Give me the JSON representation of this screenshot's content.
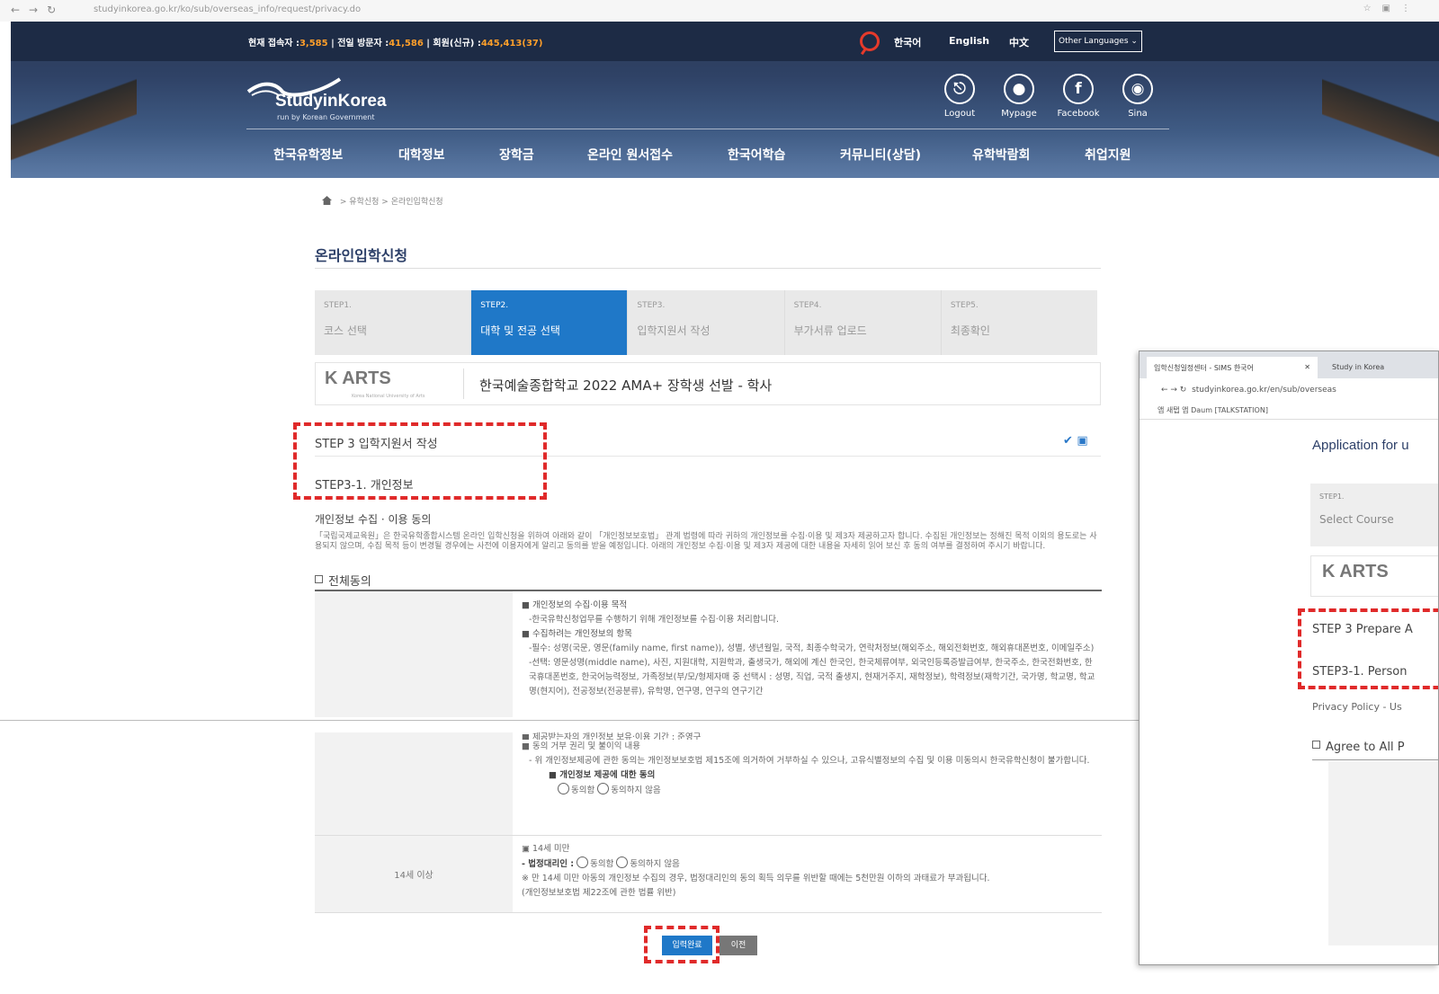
{
  "browser": {
    "url": "studyinkorea.go.kr/ko/sub/overseas_info/request/privacy.do"
  },
  "header": {
    "stats": {
      "now_label": "현재 접속자 :",
      "now_value": "3,585",
      "yesterday_label": "| 전일 방문자 :",
      "yesterday_value": "41,586",
      "members_label": "| 회원(신규) :",
      "members_value": "445,413(37)"
    },
    "languages": [
      "한국어",
      "English",
      "中文"
    ],
    "other_languages": "Other Languages",
    "logo": {
      "name": "StudyinKorea",
      "sub": "run by Korean Government"
    },
    "user_icons": [
      {
        "label": "Logout",
        "icon": "logout-icon",
        "glyph": "⎋"
      },
      {
        "label": "Mypage",
        "icon": "user-icon",
        "glyph": "👤"
      },
      {
        "label": "Facebook",
        "icon": "facebook-icon",
        "glyph": "f"
      },
      {
        "label": "Sina",
        "icon": "sina-icon",
        "glyph": "◉"
      }
    ],
    "menu": [
      "한국유학정보",
      "대학정보",
      "장학금",
      "온라인 원서접수",
      "한국어학습",
      "커뮤니티(상담)",
      "유학박람회",
      "취업지원"
    ]
  },
  "breadcrumb": {
    "items": [
      "유학신청",
      "온라인입학신청"
    ]
  },
  "page_title": "온라인입학신청",
  "steps": [
    {
      "no": "STEP1.",
      "label": "코스 선택",
      "active": false
    },
    {
      "no": "STEP2.",
      "label": "대학 및 전공 선택",
      "active": true
    },
    {
      "no": "STEP3.",
      "label": "입학지원서 작성",
      "active": false
    },
    {
      "no": "STEP4.",
      "label": "부가서류 업로드",
      "active": false
    },
    {
      "no": "STEP5.",
      "label": "최종확인",
      "active": false
    }
  ],
  "school": {
    "logo_text": "K ARTS",
    "logo_sub": "Korea National University of Arts",
    "name": "한국예술종합학교 2022 AMA+ 장학생 선발 - 학사"
  },
  "step3": {
    "title": "STEP 3 입학지원서 작성",
    "tools": "✔ ▣",
    "sub_title": "STEP3-1. 개인정보"
  },
  "privacy": {
    "title": "개인정보 수집 · 이용 동의",
    "desc": "「국립국제교육원」은 한국유학종합시스템 온라인 입학신청을 위하여 아래와 같이 「개인정보보호법」 관계 법령에 따라 귀하의 개인정보를 수집·이용 및 제3자 제공하고자 합니다. 수집된 개인정보는 정해진 목적 이외의 용도로는 사용되지 않으며, 수집 목적 등이 변경될 경우에는 사전에 이용자에게 알리고 동의를 받을 예정입니다. 아래의 개인정보 수집·이용 및 제3자 제공에 대한 내용을 자세히 읽어 보신 후 동의 여부를 결정하여 주시기 바랍니다.",
    "agree_all": "전체동의",
    "section1": {
      "h1": "■ 개인정보의 수집·이용 목적",
      "l1": "-한국유학신청업무를 수행하기 위해 개인정보를 수집·이용 처리합니다.",
      "h2": "■ 수집하려는 개인정보의 항목",
      "l2": "-필수: 성명(국문, 영문(family name, first name)), 성별, 생년월일, 국적, 최종수학국가, 연락처정보(해외주소, 해외전화번호, 해외휴대폰번호, 이메일주소)",
      "l3": "-선택: 영문성명(middle name), 사진, 지원대학, 지원학과, 출생국가, 해외에 계신 한국인, 한국체류여부, 외국인등록증발급여부, 한국주소, 한국전화번호, 한국휴대폰번호, 한국어능력정보, 가족정보(부/모/형제자매 중 선택시 : 성명, 직업, 국적 출생지, 현재거주지, 재학정보), 학력정보(재학기간, 국가명, 학교명, 학교명(현지어), 전공정보(전공분류), 유학명, 연구명, 연구의 연구기간"
    },
    "section2": {
      "h0": "■ 제공받는자의 개인정보 보유·이용 기간 : 준영구",
      "h1": "■ 동의 거부 권리 및 불이익 내용",
      "l1": "- 위 개인정보제공에 관한 동의는 개인정보보호법 제15조에 의거하여 거부하실 수 있으나, 고유식별정보의 수집 및 이용 미동의시 한국유학신청이 불가합니다.",
      "consent_title": "■ 개인정보 제공에 대한 동의",
      "agree": "동의함",
      "disagree": "동의하지 않음"
    },
    "section3": {
      "left_label": "14세 이상",
      "h1": "▣ 14세 미만",
      "guardian": "- 법정대리인 :",
      "agree": "동의함",
      "disagree": "동의하지 않음",
      "note": "※ 만 14세 미만 아동의 개인정보 수집의 경우, 법정대리인의 동의 획득 의무를 위반할 때에는 5천만원 이하의 과태료가 부과됩니다.",
      "law": "(개인정보보호법 제22조에 관한 법률 위반)"
    }
  },
  "buttons": {
    "submit": "입력완료",
    "prev": "이전"
  },
  "inset": {
    "tab1": "입학신청일정센터 - SIMS 한국어",
    "tab1_close": "✕",
    "tab2": "Study in Korea",
    "url": "studyinkorea.go.kr/en/sub/overseas",
    "bookmarks": "앱  새탭  앱  Daum  [TALKSTATION]",
    "title": "Application for u",
    "step_no": "STEP1.",
    "step_label": "Select Course",
    "logo_text": "K ARTS",
    "step3": "STEP 3 Prepare A",
    "step31": "STEP3-1. Person",
    "privacy": "Privacy Policy - Us",
    "agree_all": "Agree to All P"
  }
}
